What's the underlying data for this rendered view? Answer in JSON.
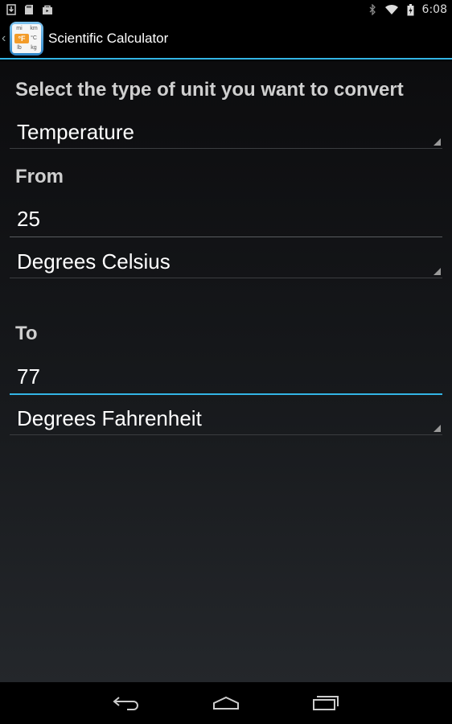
{
  "status_bar": {
    "time": "6:08",
    "left_icons": [
      "download-icon",
      "sd-card-icon",
      "shopping-bag-icon"
    ],
    "right_icons": [
      "bluetooth-icon",
      "wifi-icon",
      "battery-icon"
    ]
  },
  "action_bar": {
    "title": "Scientific Calculator",
    "icon_cells": [
      "mi",
      "km",
      "",
      "°C",
      "lb",
      "kg"
    ],
    "icon_badge": "°F"
  },
  "form": {
    "type_label": "Select the type of unit you want to convert",
    "type_value": "Temperature",
    "from_label": "From",
    "from_value": "25",
    "from_unit": "Degrees Celsius",
    "to_label": "To",
    "to_value": "77",
    "to_unit": "Degrees Fahrenheit"
  },
  "nav_bar": {
    "buttons": [
      "back-icon",
      "home-icon",
      "recents-icon"
    ]
  },
  "colors": {
    "accent": "#33b5e5",
    "background_top": "#0c0c0e",
    "background_bottom": "#24272b"
  }
}
